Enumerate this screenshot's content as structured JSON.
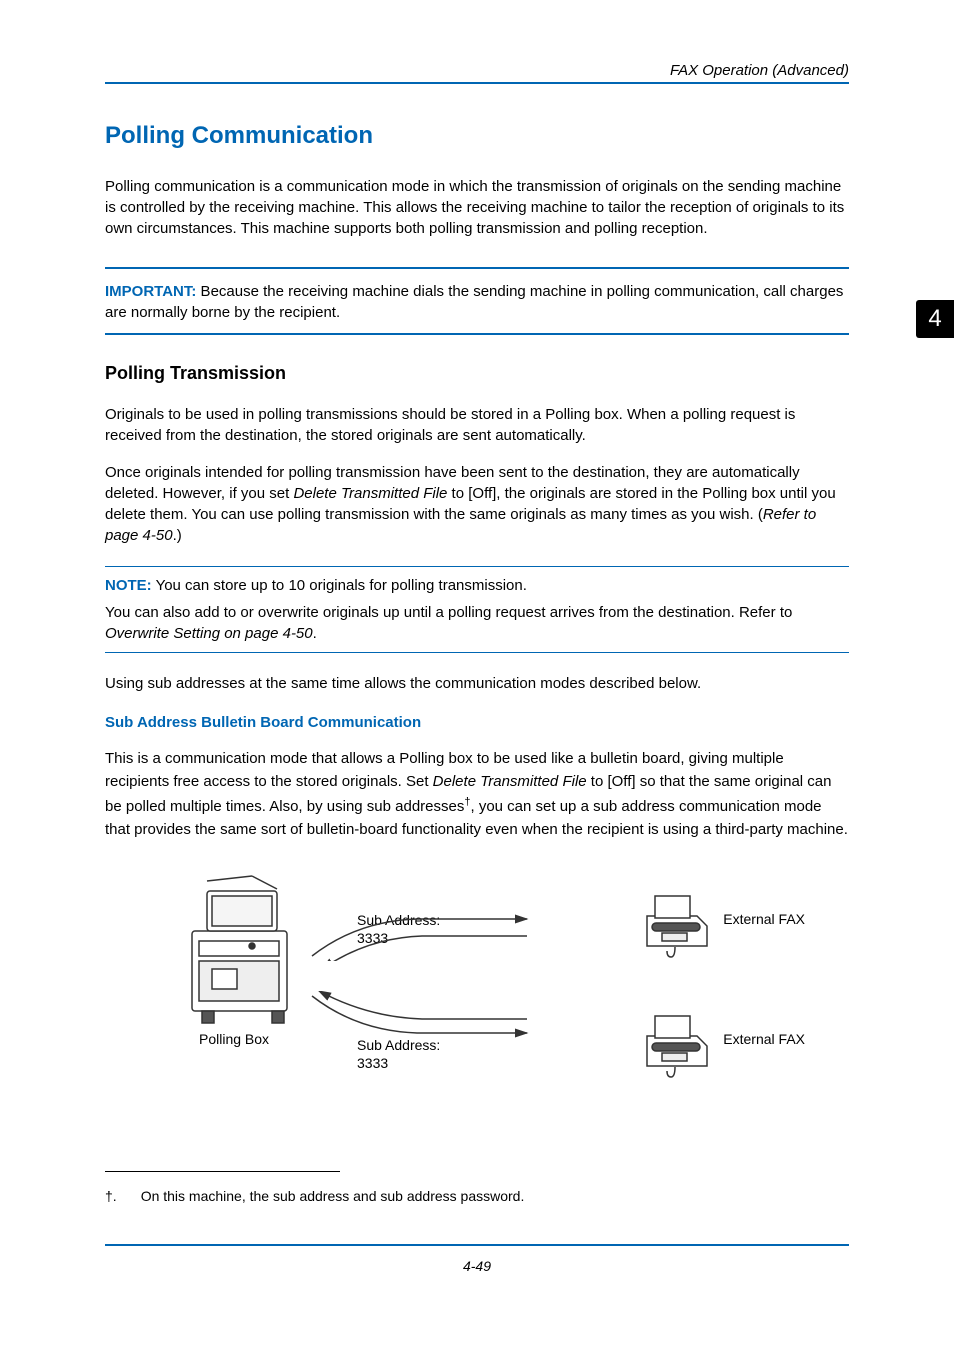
{
  "header": {
    "title": "FAX Operation (Advanced)"
  },
  "chapter_tab": "4",
  "h1": "Polling Communication",
  "intro": "Polling communication is a communication mode in which the transmission of originals on the sending machine is controlled by the receiving machine. This allows the receiving machine to tailor the reception of originals to its own circumstances. This machine supports both polling transmission and polling reception.",
  "important": {
    "label": "IMPORTANT:",
    "text": " Because the receiving machine dials the sending machine in polling communication, call charges are normally borne by the recipient."
  },
  "h2": "Polling Transmission",
  "pt_para1": "Originals to be used in polling transmissions should be stored in a Polling box. When a polling request is received from the destination, the stored originals are sent automatically.",
  "pt_para2a": "Once originals intended for polling transmission have been sent to the destination, they are automatically deleted. However, if you set ",
  "pt_para2b": "Delete Transmitted File",
  "pt_para2c": " to [Off], the originals are stored in the Polling box until you delete them. You can use polling transmission with the same originals as many times as you wish. (",
  "pt_para2d": "Refer to page 4-50",
  "pt_para2e": ".)",
  "note": {
    "label": "NOTE:",
    "line1": " You can store up to 10 originals for polling transmission.",
    "line2a": "You can also add to or overwrite originals up until a polling request arrives from the destination. Refer to ",
    "line2b": "Overwrite Setting on page 4-50",
    "line2c": "."
  },
  "using_para": "Using sub addresses at the same time allows the communication modes described below.",
  "h3": "Sub Address Bulletin Board Communication",
  "bb_a": "This is a communication mode that allows a Polling box to be used like a bulletin board, giving multiple recipients free access to the stored originals. Set ",
  "bb_b": "Delete Transmitted File",
  "bb_c": " to [Off] so that the same original can be polled multiple times. Also, by using sub addresses",
  "bb_sup": "†",
  "bb_d": ", you can set up a sub address communication mode that provides the same sort of bulletin-board functionality even when the recipient is using a third-party machine.",
  "diagram": {
    "polling_box": "Polling Box",
    "sub_addr_label": "Sub Address:",
    "sub_addr_val": "3333",
    "external_fax": "External FAX"
  },
  "footnote": {
    "marker": "†.",
    "text": "On this machine, the sub address and sub address password."
  },
  "page_number": "4-49"
}
